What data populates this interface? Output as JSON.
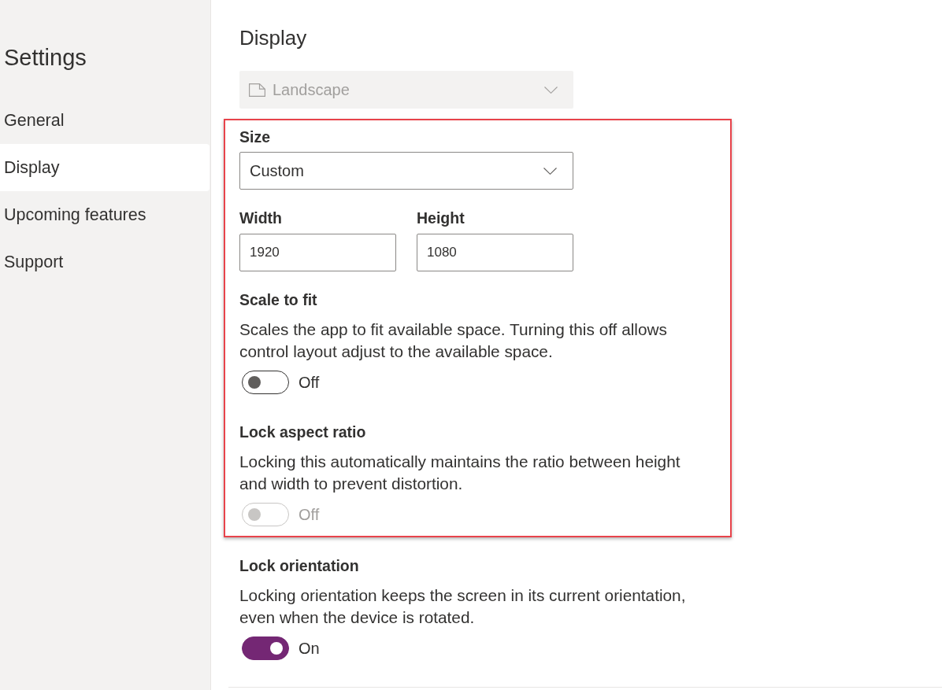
{
  "sidebar": {
    "title": "Settings",
    "items": [
      {
        "label": "General",
        "selected": false
      },
      {
        "label": "Display",
        "selected": true
      },
      {
        "label": "Upcoming features",
        "selected": false
      },
      {
        "label": "Support",
        "selected": false
      }
    ]
  },
  "page": {
    "title": "Display"
  },
  "settings": [
    {
      "kind": "page_select",
      "value": "Landscape",
      "disabled": true,
      "highlighted": false
    },
    {
      "kind": "select",
      "label": "Size",
      "value": "Custom",
      "disabled": false,
      "highlighted": true
    },
    {
      "kind": "number_pair",
      "fields": [
        {
          "label": "Width",
          "value": "1920"
        },
        {
          "label": "Height",
          "value": "1080"
        }
      ],
      "highlighted": true
    },
    {
      "kind": "toggle",
      "title": "Scale to fit",
      "description": "Scales the app to fit available space. Turning this off allows control layout adjust to the available space.",
      "on": false,
      "disabled": false,
      "state_label": "Off",
      "highlighted": true
    },
    {
      "kind": "toggle",
      "title": "Lock aspect ratio",
      "description": "Locking this automatically maintains the ratio between height and width to prevent distortion.",
      "on": false,
      "disabled": true,
      "state_label": "Off",
      "highlighted": true
    },
    {
      "kind": "toggle",
      "title": "Lock orientation",
      "description": "Locking orientation keeps the screen in its current orientation, even when the device is rotated.",
      "on": true,
      "disabled": false,
      "state_label": "On",
      "highlighted": false
    }
  ]
}
